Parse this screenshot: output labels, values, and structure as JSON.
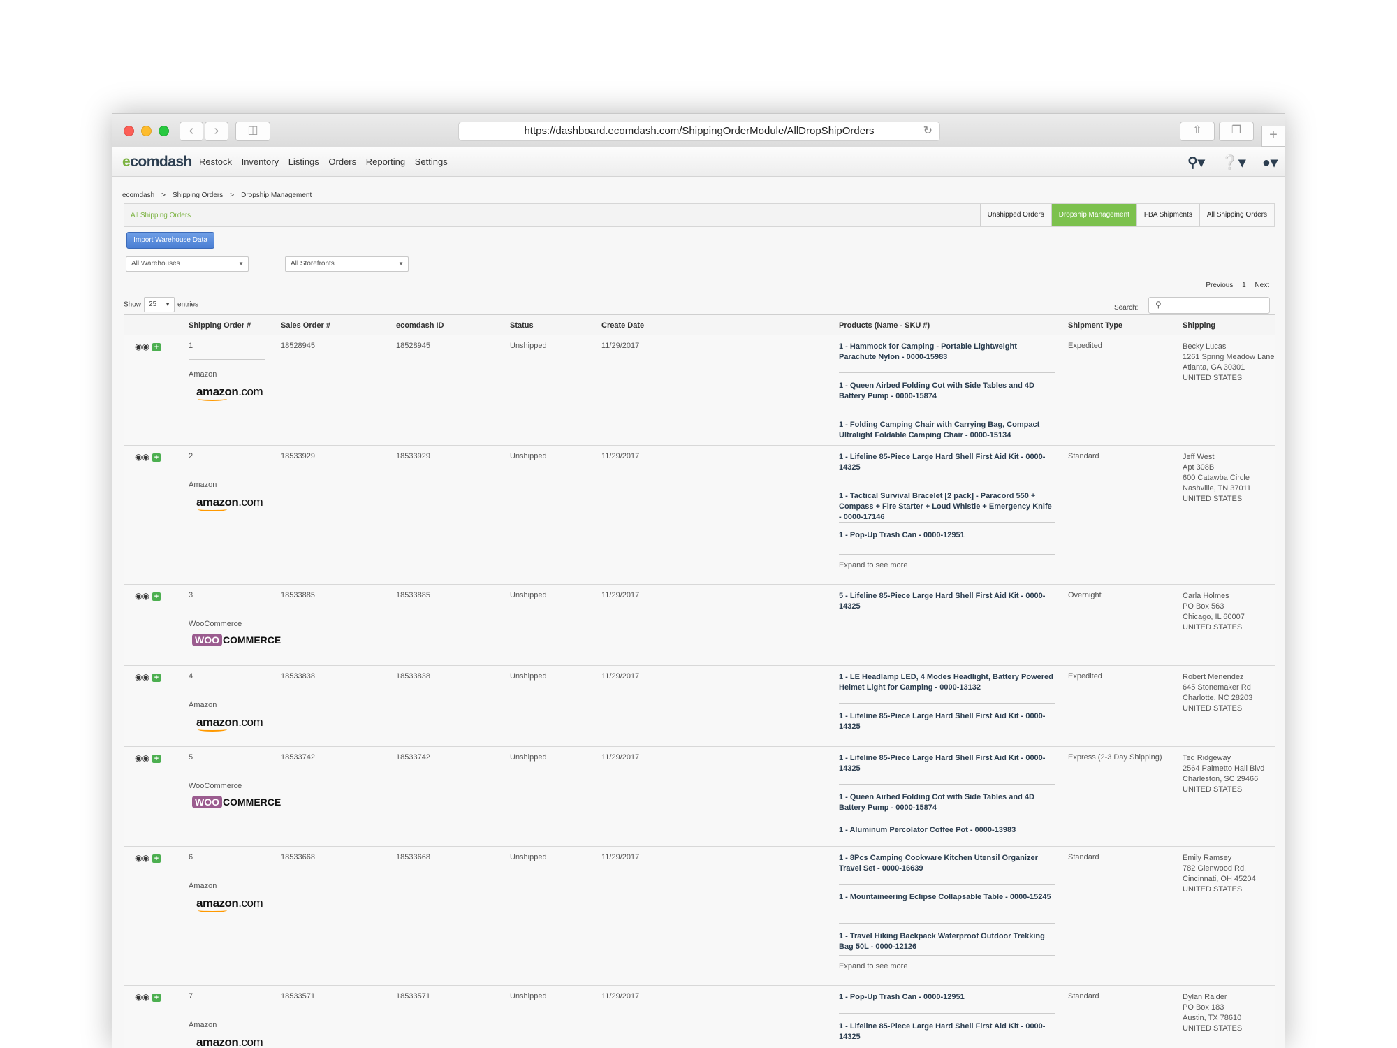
{
  "browser": {
    "url": "https://dashboard.ecomdash.com/ShippingOrderModule/AllDropShipOrders"
  },
  "nav": {
    "logo_prefix": "e",
    "logo_rest": "comdash",
    "links": [
      "Restock",
      "Inventory",
      "Listings",
      "Orders",
      "Reporting",
      "Settings"
    ]
  },
  "breadcrumb": [
    "ecomdash",
    "Shipping Orders",
    "Dropship Management"
  ],
  "tabsbar": {
    "title": "All Shipping Orders",
    "tabs": [
      "Unshipped Orders",
      "Dropship Management",
      "FBA Shipments",
      "All Shipping Orders"
    ],
    "active": "Dropship Management"
  },
  "import_button": "Import Warehouse Data",
  "filters": {
    "warehouse": "All Warehouses",
    "storefront": "All Storefronts"
  },
  "pager": {
    "prev": "Previous",
    "page": "1",
    "next": "Next"
  },
  "show": {
    "label": "Show",
    "value": "25",
    "suffix": "entries"
  },
  "search": {
    "label": "Search:"
  },
  "columns": [
    "Shipping Order #",
    "Sales Order #",
    "ecomdash ID",
    "Status",
    "Create Date",
    "Products (Name - SKU #)",
    "Shipment Type",
    "Shipping"
  ],
  "rows": [
    {
      "ship_no": "1",
      "sales": "18528945",
      "ecom": "18528945",
      "status": "Unshipped",
      "date": "11/29/2017",
      "store": "Amazon",
      "store_logo": "amazon",
      "products": [
        "1 - Hammock for Camping - Portable Lightweight Parachute Nylon - 0000-15983",
        "1 - Queen Airbed Folding Cot with Side Tables and 4D Battery Pump - 0000-15874",
        "1 - Folding Camping Chair with Carrying Bag, Compact Ultralight Foldable Camping Chair - 0000-15134"
      ],
      "expand": "",
      "shipment": "Expedited",
      "address": [
        "Becky Lucas",
        "1261 Spring Meadow Lane",
        "Atlanta, GA 30301",
        "UNITED STATES"
      ]
    },
    {
      "ship_no": "2",
      "sales": "18533929",
      "ecom": "18533929",
      "status": "Unshipped",
      "date": "11/29/2017",
      "store": "Amazon",
      "store_logo": "amazon",
      "products": [
        "1 - Lifeline 85-Piece Large Hard Shell First Aid Kit - 0000-14325",
        "1 - Tactical Survival Bracelet [2 pack] - Paracord 550 + Compass + Fire Starter + Loud Whistle + Emergency Knife - 0000-17146",
        "1 - Pop-Up Trash Can - 0000-12951"
      ],
      "expand": "Expand to see more",
      "shipment": "Standard",
      "address": [
        "Jeff West",
        "Apt 308B",
        "600 Catawba Circle",
        "Nashville, TN 37011",
        "UNITED STATES"
      ]
    },
    {
      "ship_no": "3",
      "sales": "18533885",
      "ecom": "18533885",
      "status": "Unshipped",
      "date": "11/29/2017",
      "store": "WooCommerce",
      "store_logo": "woo",
      "products": [
        "5 - Lifeline 85-Piece Large Hard Shell First Aid Kit - 0000-14325"
      ],
      "expand": "",
      "shipment": "Overnight",
      "address": [
        "Carla Holmes",
        "PO Box 563",
        "Chicago, IL 60007",
        "UNITED STATES"
      ]
    },
    {
      "ship_no": "4",
      "sales": "18533838",
      "ecom": "18533838",
      "status": "Unshipped",
      "date": "11/29/2017",
      "store": "Amazon",
      "store_logo": "amazon",
      "products": [
        "1 - LE Headlamp LED, 4 Modes Headlight, Battery Powered Helmet Light for Camping - 0000-13132",
        "1 - Lifeline 85-Piece Large Hard Shell First Aid Kit - 0000-14325"
      ],
      "expand": "",
      "shipment": "Expedited",
      "address": [
        "Robert Menendez",
        "645 Stonemaker Rd",
        "Charlotte, NC 28203",
        "UNITED STATES"
      ]
    },
    {
      "ship_no": "5",
      "sales": "18533742",
      "ecom": "18533742",
      "status": "Unshipped",
      "date": "11/29/2017",
      "store": "WooCommerce",
      "store_logo": "woo",
      "products": [
        "1 - Lifeline 85-Piece Large Hard Shell First Aid Kit - 0000-14325",
        "1 - Queen Airbed Folding Cot with Side Tables and 4D Battery Pump - 0000-15874",
        "1 - Aluminum Percolator Coffee Pot - 0000-13983"
      ],
      "expand": "",
      "shipment": "Express (2-3 Day Shipping)",
      "address": [
        "Ted Ridgeway",
        "2564 Palmetto Hall Blvd",
        "Charleston, SC 29466",
        "UNITED STATES"
      ]
    },
    {
      "ship_no": "6",
      "sales": "18533668",
      "ecom": "18533668",
      "status": "Unshipped",
      "date": "11/29/2017",
      "store": "Amazon",
      "store_logo": "amazon",
      "products": [
        "1 - 8Pcs Camping Cookware Kitchen Utensil Organizer Travel Set - 0000-16639",
        "1 - Mountaineering Eclipse Collapsable Table - 0000-15245",
        "1 - Travel Hiking Backpack Waterproof Outdoor Trekking Bag 50L - 0000-12126"
      ],
      "expand": "Expand to see more",
      "shipment": "Standard",
      "address": [
        "Emily Ramsey",
        "782 Glenwood Rd.",
        "Cincinnati, OH 45204",
        "UNITED STATES"
      ]
    },
    {
      "ship_no": "7",
      "sales": "18533571",
      "ecom": "18533571",
      "status": "Unshipped",
      "date": "11/29/2017",
      "store": "Amazon",
      "store_logo": "amazon",
      "products": [
        "1 - Pop-Up Trash Can - 0000-12951",
        "1 - Lifeline 85-Piece Large Hard Shell First Aid Kit - 0000-14325"
      ],
      "expand": "",
      "shipment": "Standard",
      "address": [
        "Dylan Raider",
        "PO Box 183",
        "Austin, TX 78610",
        "UNITED STATES"
      ]
    }
  ],
  "icons": {
    "view": "binoculars-icon",
    "add": "plus-icon",
    "delete": "delete-icon"
  }
}
